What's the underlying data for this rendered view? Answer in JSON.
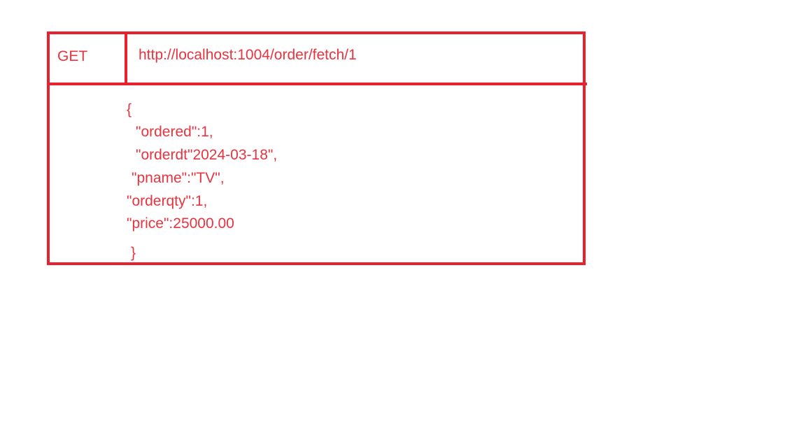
{
  "request": {
    "method": "GET",
    "url": "http://localhost:1004/order/fetch/1"
  },
  "response": {
    "lines": [
      "{",
      "\"ordered\":1,",
      "\"orderdt\"2024-03-18\",",
      "\"pname\":\"TV\",",
      "\"orderqty\":1,",
      "\"price\":25000.00",
      "}"
    ]
  },
  "colors": {
    "accent": "#e8212e",
    "text": "#e8343f"
  }
}
